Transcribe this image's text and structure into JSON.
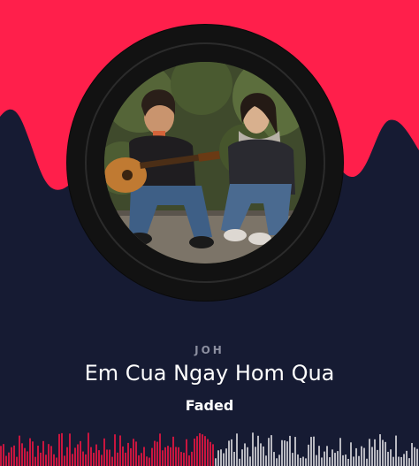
{
  "colors": {
    "accent": "#ff1f4b",
    "background": "#161b33",
    "disc": "#121212",
    "played": "#c9163f",
    "unplayed": "#b8b8c0",
    "subtle_text": "#8c8fa0"
  },
  "track": {
    "artist": "JOH",
    "title": "Em Cua Ngay Hom Qua",
    "album": "Faded",
    "cover_description": "two-people-with-guitar"
  },
  "progress": {
    "played_fraction": 0.51
  }
}
